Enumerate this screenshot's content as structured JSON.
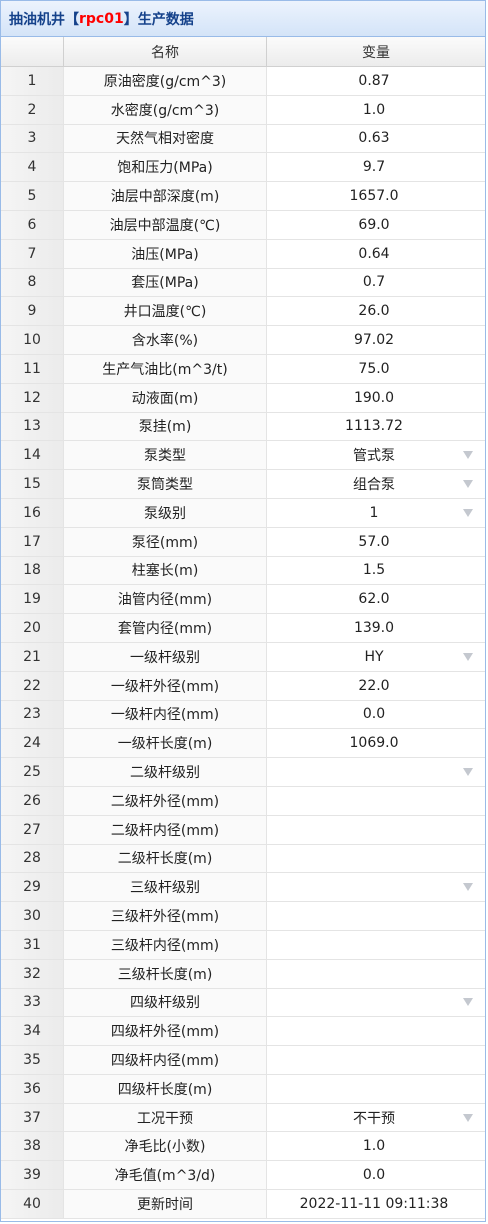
{
  "title": {
    "prefix": "抽油机井【",
    "well": "rpc01",
    "suffix": "】生产数据"
  },
  "header": {
    "col_name": "名称",
    "col_value": "变量"
  },
  "rows": [
    {
      "num": "1",
      "name": "原油密度(g/cm^3)",
      "value": "0.87",
      "dropdown": false
    },
    {
      "num": "2",
      "name": "水密度(g/cm^3)",
      "value": "1.0",
      "dropdown": false
    },
    {
      "num": "3",
      "name": "天然气相对密度",
      "value": "0.63",
      "dropdown": false
    },
    {
      "num": "4",
      "name": "饱和压力(MPa)",
      "value": "9.7",
      "dropdown": false
    },
    {
      "num": "5",
      "name": "油层中部深度(m)",
      "value": "1657.0",
      "dropdown": false
    },
    {
      "num": "6",
      "name": "油层中部温度(℃)",
      "value": "69.0",
      "dropdown": false
    },
    {
      "num": "7",
      "name": "油压(MPa)",
      "value": "0.64",
      "dropdown": false
    },
    {
      "num": "8",
      "name": "套压(MPa)",
      "value": "0.7",
      "dropdown": false
    },
    {
      "num": "9",
      "name": "井口温度(℃)",
      "value": "26.0",
      "dropdown": false
    },
    {
      "num": "10",
      "name": "含水率(%)",
      "value": "97.02",
      "dropdown": false
    },
    {
      "num": "11",
      "name": "生产气油比(m^3/t)",
      "value": "75.0",
      "dropdown": false
    },
    {
      "num": "12",
      "name": "动液面(m)",
      "value": "190.0",
      "dropdown": false
    },
    {
      "num": "13",
      "name": "泵挂(m)",
      "value": "1113.72",
      "dropdown": false
    },
    {
      "num": "14",
      "name": "泵类型",
      "value": "管式泵",
      "dropdown": true
    },
    {
      "num": "15",
      "name": "泵筒类型",
      "value": "组合泵",
      "dropdown": true
    },
    {
      "num": "16",
      "name": "泵级别",
      "value": "1",
      "dropdown": true
    },
    {
      "num": "17",
      "name": "泵径(mm)",
      "value": "57.0",
      "dropdown": false
    },
    {
      "num": "18",
      "name": "柱塞长(m)",
      "value": "1.5",
      "dropdown": false
    },
    {
      "num": "19",
      "name": "油管内径(mm)",
      "value": "62.0",
      "dropdown": false
    },
    {
      "num": "20",
      "name": "套管内径(mm)",
      "value": "139.0",
      "dropdown": false
    },
    {
      "num": "21",
      "name": "一级杆级别",
      "value": "HY",
      "dropdown": true
    },
    {
      "num": "22",
      "name": "一级杆外径(mm)",
      "value": "22.0",
      "dropdown": false
    },
    {
      "num": "23",
      "name": "一级杆内径(mm)",
      "value": "0.0",
      "dropdown": false
    },
    {
      "num": "24",
      "name": "一级杆长度(m)",
      "value": "1069.0",
      "dropdown": false
    },
    {
      "num": "25",
      "name": "二级杆级别",
      "value": "",
      "dropdown": true
    },
    {
      "num": "26",
      "name": "二级杆外径(mm)",
      "value": "",
      "dropdown": false
    },
    {
      "num": "27",
      "name": "二级杆内径(mm)",
      "value": "",
      "dropdown": false
    },
    {
      "num": "28",
      "name": "二级杆长度(m)",
      "value": "",
      "dropdown": false
    },
    {
      "num": "29",
      "name": "三级杆级别",
      "value": "",
      "dropdown": true
    },
    {
      "num": "30",
      "name": "三级杆外径(mm)",
      "value": "",
      "dropdown": false
    },
    {
      "num": "31",
      "name": "三级杆内径(mm)",
      "value": "",
      "dropdown": false
    },
    {
      "num": "32",
      "name": "三级杆长度(m)",
      "value": "",
      "dropdown": false
    },
    {
      "num": "33",
      "name": "四级杆级别",
      "value": "",
      "dropdown": true
    },
    {
      "num": "34",
      "name": "四级杆外径(mm)",
      "value": "",
      "dropdown": false
    },
    {
      "num": "35",
      "name": "四级杆内径(mm)",
      "value": "",
      "dropdown": false
    },
    {
      "num": "36",
      "name": "四级杆长度(m)",
      "value": "",
      "dropdown": false
    },
    {
      "num": "37",
      "name": "工况干预",
      "value": "不干预",
      "dropdown": true
    },
    {
      "num": "38",
      "name": "净毛比(小数)",
      "value": "1.0",
      "dropdown": false
    },
    {
      "num": "39",
      "name": "净毛值(m^3/d)",
      "value": "0.0",
      "dropdown": false
    },
    {
      "num": "40",
      "name": "更新时间",
      "value": "2022-11-11 09:11:38",
      "dropdown": false
    }
  ],
  "icons": {
    "dropdown": "chevron-down-icon"
  },
  "colors": {
    "title_text": "#15428b",
    "title_highlight": "#ff0000",
    "border": "#99bbe8"
  }
}
